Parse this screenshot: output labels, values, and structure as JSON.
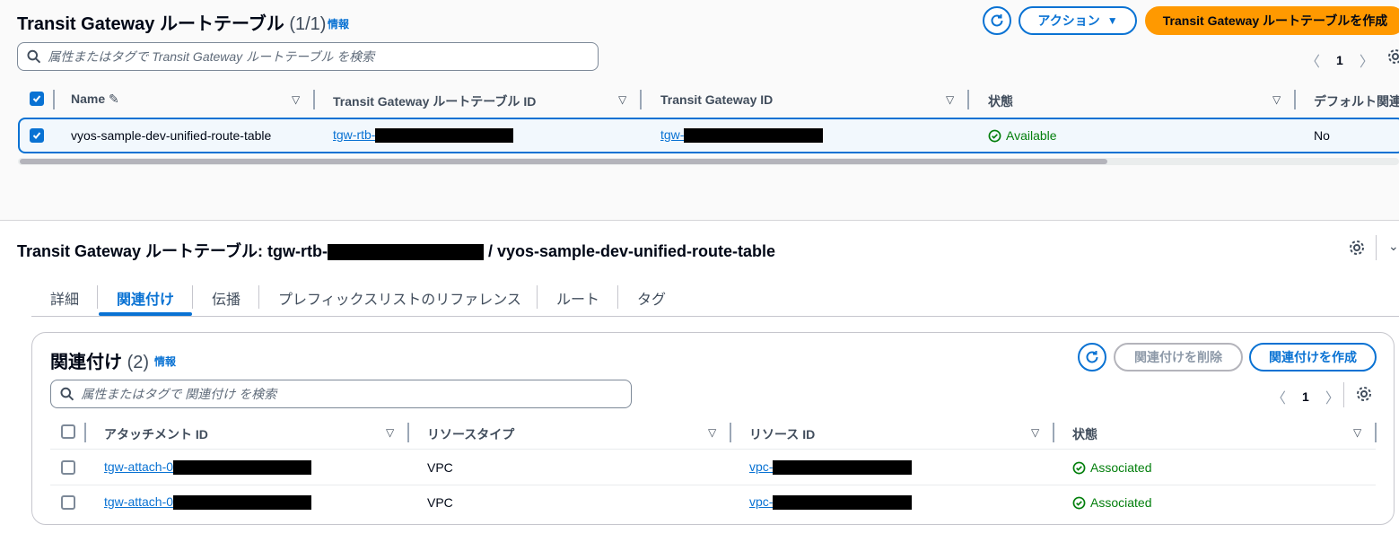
{
  "top": {
    "title": "Transit Gateway ルートテーブル",
    "count": "(1/1)",
    "info": "情報",
    "actions_label": "アクション",
    "create_label": "Transit Gateway ルートテーブルを作成",
    "search_placeholder": "属性またはタグで Transit Gateway ルートテーブル を検索",
    "page": "1",
    "columns": [
      "Name",
      "Transit Gateway ルートテーブル ID",
      "Transit Gateway ID",
      "状態",
      "デフォルト関連"
    ],
    "row": {
      "name": "vyos-sample-dev-unified-route-table",
      "rtb_prefix": "tgw-rtb-",
      "tgw_prefix": "tgw-",
      "state": "Available",
      "default_assoc": "No"
    }
  },
  "detail": {
    "title_prefix": "Transit Gateway ルートテーブル: tgw-rtb-",
    "title_suffix": " / vyos-sample-dev-unified-route-table",
    "tabs": [
      "詳細",
      "関連付け",
      "伝播",
      "プレフィックスリストのリファレンス",
      "ルート",
      "タグ"
    ]
  },
  "assoc": {
    "title": "関連付け",
    "count": "(2)",
    "info": "情報",
    "delete_label": "関連付けを削除",
    "create_label": "関連付けを作成",
    "search_placeholder": "属性またはタグで 関連付け を検索",
    "page": "1",
    "columns": [
      "アタッチメント ID",
      "リソースタイプ",
      "リソース ID",
      "状態"
    ],
    "rows": [
      {
        "attach_prefix": "tgw-attach-0",
        "type": "VPC",
        "resource_prefix": "vpc-",
        "state": "Associated"
      },
      {
        "attach_prefix": "tgw-attach-0",
        "type": "VPC",
        "resource_prefix": "vpc-",
        "state": "Associated"
      }
    ]
  }
}
